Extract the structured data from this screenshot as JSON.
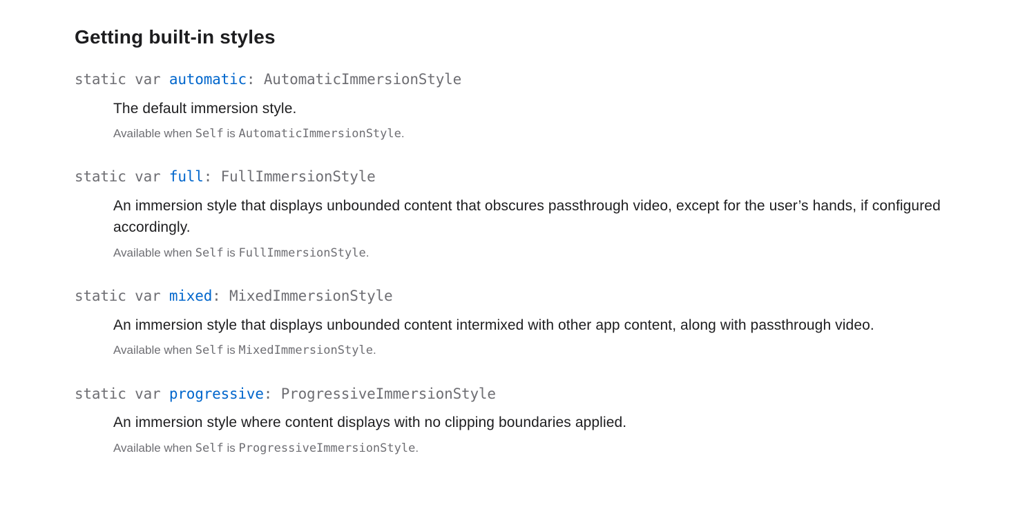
{
  "section_title": "Getting built-in styles",
  "kw_static": "static",
  "kw_var": "var",
  "avail_prefix": "Available when ",
  "avail_self": "Self",
  "avail_is": " is ",
  "avail_period": ".",
  "symbols": [
    {
      "name": "automatic",
      "type": "AutomaticImmersionStyle",
      "abstract": "The default immersion style.",
      "constraint_type": "AutomaticImmersionStyle"
    },
    {
      "name": "full",
      "type": "FullImmersionStyle",
      "abstract": "An immersion style that displays unbounded content that obscures passthrough video, except for the user’s hands, if configured accordingly.",
      "constraint_type": "FullImmersionStyle"
    },
    {
      "name": "mixed",
      "type": "MixedImmersionStyle",
      "abstract": "An immersion style that displays unbounded content intermixed with other app content, along with passthrough video.",
      "constraint_type": "MixedImmersionStyle"
    },
    {
      "name": "progressive",
      "type": "ProgressiveImmersionStyle",
      "abstract": "An immersion style where content displays with no clipping boundaries applied.",
      "constraint_type": "ProgressiveImmersionStyle"
    }
  ]
}
